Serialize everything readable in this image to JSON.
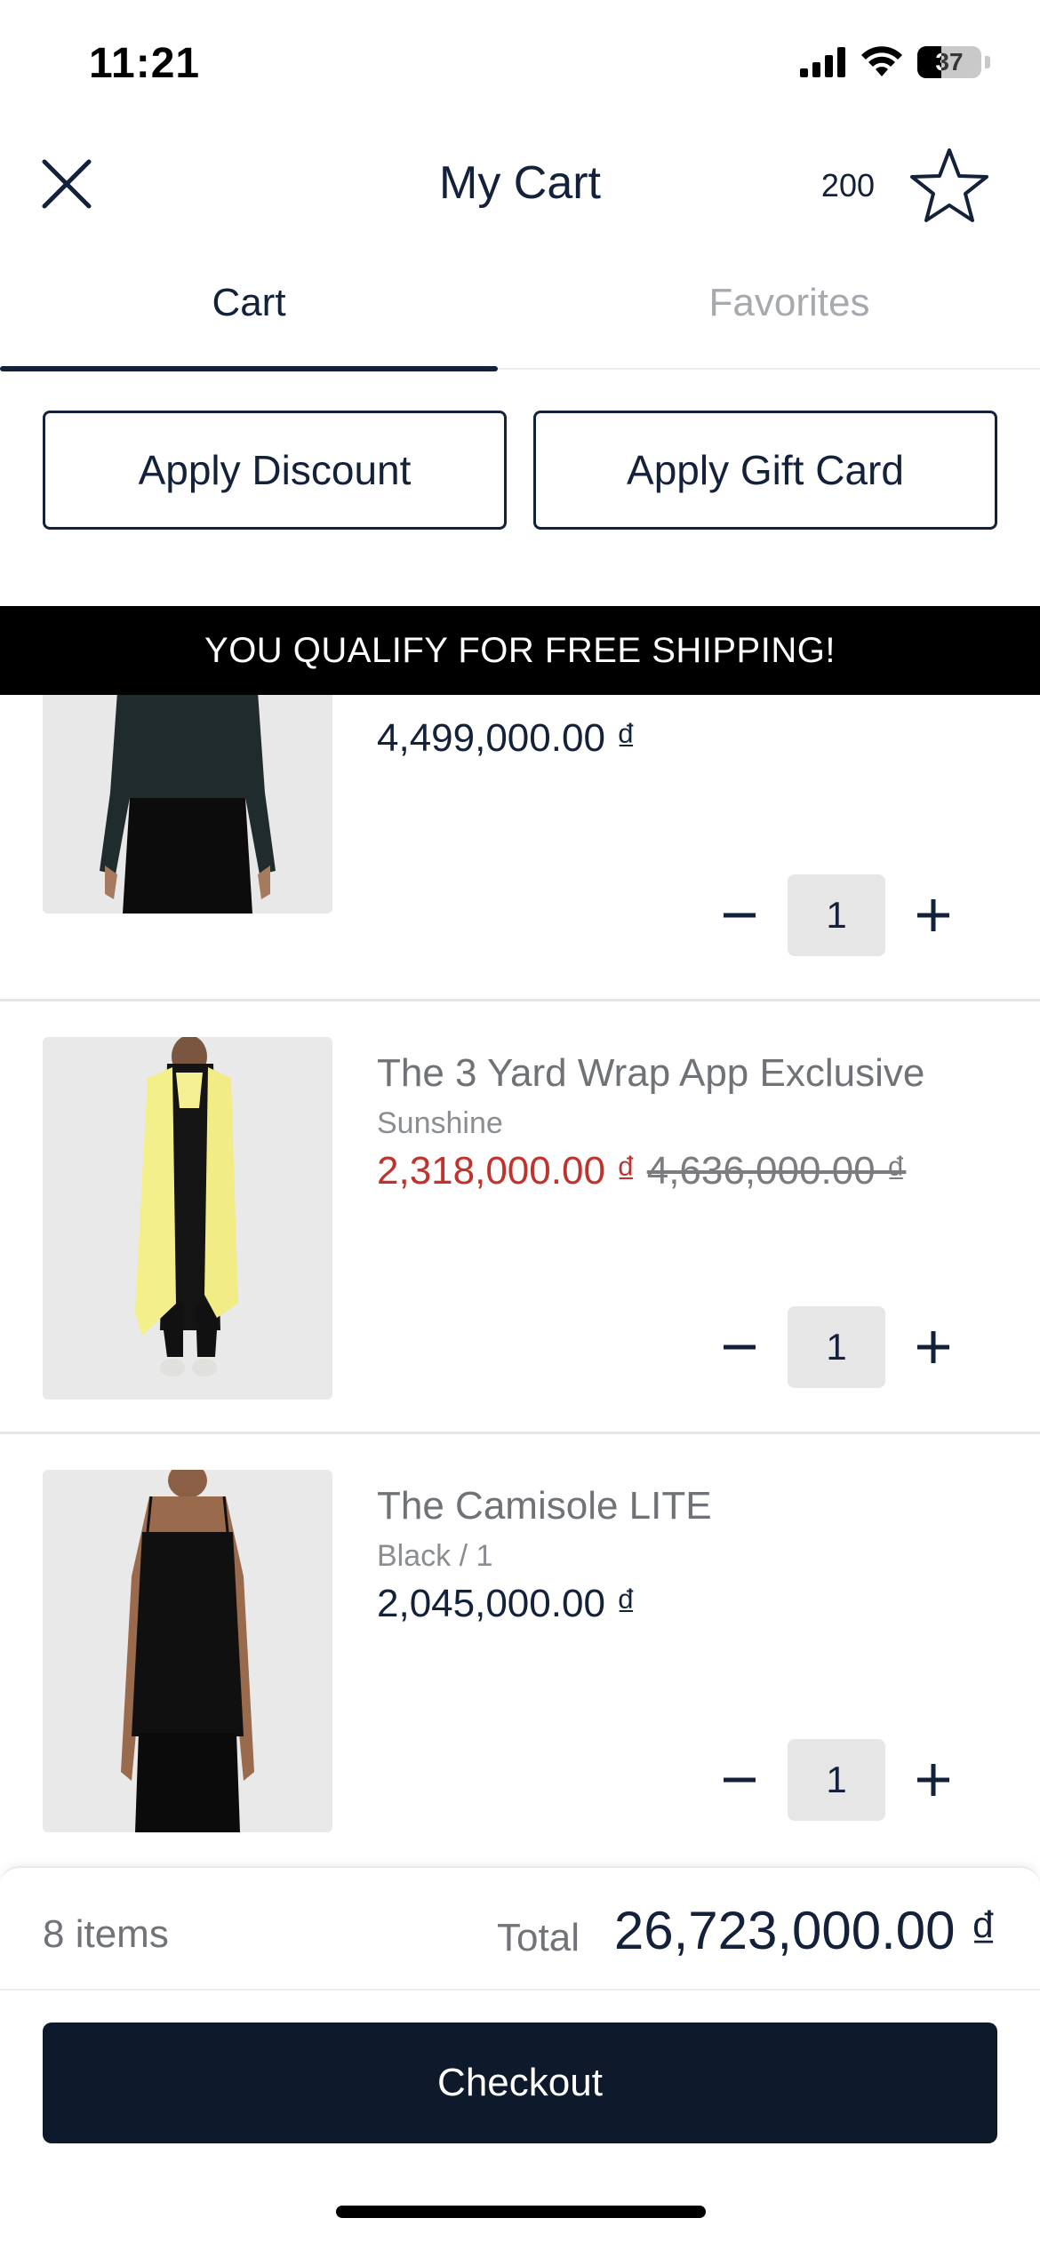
{
  "status_bar": {
    "time": "11:21",
    "battery": "37"
  },
  "header": {
    "title": "My Cart",
    "points": "200"
  },
  "tabs": [
    {
      "label": "Cart"
    },
    {
      "label": "Favorites"
    }
  ],
  "actions": {
    "discount": "Apply Discount",
    "gift_card": "Apply Gift Card"
  },
  "banner": "YOU QUALIFY FOR FREE SHIPPING!",
  "items": [
    {
      "name": "",
      "variant": "",
      "price": "4,499,000.00 ₫",
      "qty": "1"
    },
    {
      "name": "The 3 Yard Wrap App Exclusive",
      "variant": "Sunshine",
      "sale_price": "2,318,000.00 ₫",
      "original_price": "4,636,000.00 ₫",
      "qty": "1"
    },
    {
      "name": "The Camisole LITE",
      "variant": "Black / 1",
      "price": "2,045,000.00 ₫",
      "qty": "1"
    }
  ],
  "footer": {
    "count": "8 items",
    "total_label": "Total",
    "total": "26,723,000.00 ₫",
    "checkout": "Checkout"
  },
  "colors": {
    "navy": "#0e1a2b",
    "sale_red": "#c0322b",
    "banner_bg": "#000000"
  }
}
